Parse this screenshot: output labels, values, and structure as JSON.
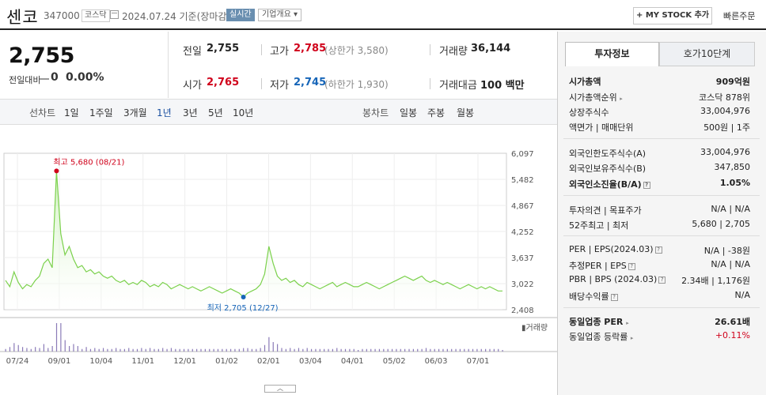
{
  "header": {
    "company_name": "센코",
    "code": "347000",
    "market": "코스닥",
    "date": "2024.07.24 기준(장마감)",
    "realtime": "실시간",
    "company_info": "기업개요 ▾",
    "my_stock": "+ MY STOCK 추가",
    "quick_order": "빠른주문"
  },
  "price": {
    "current": "2,755",
    "change_label": "전일대비",
    "change": "0",
    "rate": "0.00%"
  },
  "quote": {
    "prev_label": "전일",
    "prev": "2,755",
    "high_label": "고가",
    "high": "2,785",
    "upper_limit": "(상한가 3,580)",
    "volume_label": "거래량",
    "volume": "36,144",
    "open_label": "시가",
    "open": "2,765",
    "low_label": "저가",
    "low": "2,745",
    "lower_limit": "(하한가 1,930)",
    "amount_label": "거래대금",
    "amount": "100 백만"
  },
  "chart_nav": {
    "line_label": "선차트",
    "periods": [
      "1일",
      "1주일",
      "3개월",
      "1년",
      "3년",
      "5년",
      "10년"
    ],
    "active_period": "1년",
    "candle_label": "봉차트",
    "candles": [
      "일봉",
      "주봉",
      "월봉"
    ]
  },
  "right_panel": {
    "tabs": [
      "투자정보",
      "호가10단계"
    ],
    "market_cap_label": "시가총액",
    "market_cap": "909억원",
    "rank_label": "시가총액순위",
    "rank": "코스닥 878위",
    "shares_label": "상장주식수",
    "shares": "33,004,976",
    "par_label": "액면가 | 매매단위",
    "par": "500원 | 1주",
    "foreign_limit_label": "외국인한도주식수(A)",
    "foreign_limit": "33,004,976",
    "foreign_hold_label": "외국인보유주식수(B)",
    "foreign_hold": "347,850",
    "foreign_ratio_label": "외국인소진율(B/A)",
    "foreign_ratio": "1.05%",
    "opinion_label": "투자의견 | 목표주가",
    "opinion": "N/A | N/A",
    "w52_label": "52주최고 | 최저",
    "w52": "5,680 | 2,705",
    "per_label": "PER | EPS(2024.03)",
    "per": "N/A | -38원",
    "est_per_label": "추정PER | EPS",
    "est_per": "N/A | N/A",
    "pbr_label": "PBR | BPS (2024.03)",
    "pbr": "2.34배 | 1,176원",
    "div_label": "배당수익률",
    "div": "N/A",
    "sector_per_label": "동일업종 PER",
    "sector_per": "26.61배",
    "sector_rate_label": "동일업종 등락률",
    "sector_rate": "+0.11%"
  },
  "chart_data": {
    "type": "line",
    "y_ticks": [
      "6,097",
      "5,482",
      "4,867",
      "4,252",
      "3,637",
      "3,022",
      "2,408"
    ],
    "x_ticks": [
      "07/24",
      "09/01",
      "10/04",
      "11/01",
      "12/01",
      "01/02",
      "02/01",
      "03/04",
      "04/01",
      "05/02",
      "06/03",
      "07/01"
    ],
    "ylim": [
      2408,
      6097
    ],
    "max_label": "최고 5,680 (08/21)",
    "min_label": "최저 2,705 (12/27)",
    "volume_label": "거래량",
    "series": [
      {
        "values": [
          3100,
          2950,
          3300,
          3050,
          2900,
          3000,
          2950,
          3100,
          3200,
          3500,
          3600,
          3400,
          5680,
          4200,
          3700,
          3900,
          3600,
          3400,
          3450,
          3300,
          3350,
          3250,
          3300,
          3200,
          3150,
          3200,
          3100,
          3050,
          3100,
          3000,
          3050,
          3000,
          3100,
          3050,
          2950,
          3000,
          2950,
          3050,
          3000,
          2900,
          2950,
          3000,
          2950,
          2900,
          2950,
          2900,
          2850,
          2900,
          2950,
          2900,
          2850,
          2800,
          2850,
          2900,
          2850,
          2800,
          2705,
          2800,
          2850,
          2900,
          3000,
          3250,
          3900,
          3500,
          3200,
          3100,
          3150,
          3050,
          3100,
          3000,
          2950,
          3050,
          3000,
          2950,
          2900,
          2950,
          3000,
          3050,
          2950,
          3000,
          3050,
          3000,
          2950,
          2950,
          3000,
          3050,
          3000,
          2950,
          2900,
          2950,
          3000,
          3050,
          3100,
          3150,
          3200,
          3150,
          3100,
          3150,
          3200,
          3100,
          3050,
          3100,
          3050,
          3000,
          3050,
          3000,
          2950,
          2900,
          2950,
          3000,
          2950,
          2900,
          2950,
          2900,
          2950,
          2900,
          2850,
          2850
        ]
      }
    ]
  }
}
